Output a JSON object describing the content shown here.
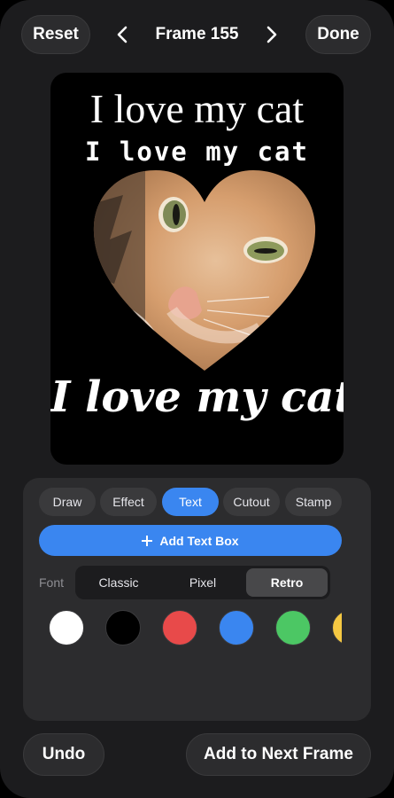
{
  "header": {
    "reset_label": "Reset",
    "frame_title": "Frame 155",
    "done_label": "Done",
    "prev_icon": "chevron-left-icon",
    "next_icon": "chevron-right-icon"
  },
  "canvas": {
    "captions": [
      "I love my cat",
      "I love my cat",
      "I love my cat"
    ],
    "photo": "heart-shaped cat photo"
  },
  "tools": {
    "tabs": [
      {
        "label": "Draw",
        "active": false
      },
      {
        "label": "Effect",
        "active": false
      },
      {
        "label": "Text",
        "active": true
      },
      {
        "label": "Cutout",
        "active": false
      },
      {
        "label": "Stamp",
        "active": false
      }
    ],
    "add_text_box_label": "Add Text Box",
    "add_icon": "plus-icon",
    "font_label": "Font",
    "fonts": [
      {
        "label": "Classic",
        "selected": false
      },
      {
        "label": "Pixel",
        "selected": false
      },
      {
        "label": "Retro",
        "selected": true
      }
    ],
    "colors": [
      "#ffffff",
      "#000000",
      "#e84a4a",
      "#3a86f0",
      "#4cc764",
      "#f5c842"
    ]
  },
  "footer": {
    "undo_label": "Undo",
    "add_next_frame_label": "Add to Next Frame"
  },
  "theme": {
    "accent": "#3a86f0",
    "background": "#1c1c1e",
    "panel": "#2c2c2e"
  }
}
